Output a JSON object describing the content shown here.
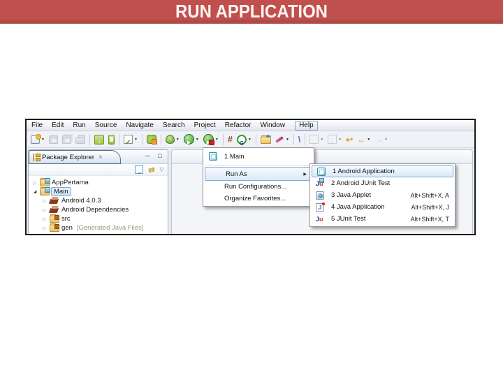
{
  "slide": {
    "title": "RUN APPLICATION",
    "banner_color": "#c0504d",
    "banner_accent_color": "#b14a47"
  },
  "glyphs": {
    "caret": "▼",
    "close": "×",
    "minimize": "─",
    "maximize": "□",
    "view_menu": "▽",
    "collapse_all": "−",
    "link_editor": "⇄",
    "expander_collapsed": "▷",
    "expander_expanded": "◢",
    "submenu_arrow": "▶",
    "run_play": "▶",
    "check": "✓",
    "down": "↓",
    "up": "↑",
    "back": "←",
    "forward": "→",
    "last_edit": "↩",
    "backslash": "\\",
    "hash": "#",
    "coverage_letter": "G",
    "j_letter": "J",
    "u_letter": "u"
  },
  "ide": {
    "menu_bar": {
      "items": [
        "File",
        "Edit",
        "Run",
        "Source",
        "Navigate",
        "Search",
        "Project",
        "Refactor",
        "Window",
        "Help"
      ]
    },
    "toolbar": {
      "icons": [
        "new-wizard",
        "save",
        "save-all",
        "print",
        "android-sdk-manager",
        "avd-manager",
        "new-test-dropdown",
        "android-lint",
        "debug",
        "run",
        "run-external",
        "java-grid",
        "coverage",
        "import-folder",
        "highlighter",
        "mark-occurrences",
        "next-annotation",
        "previous-annotation",
        "last-edit-location",
        "back",
        "forward"
      ]
    },
    "package_explorer": {
      "title": "Package Explorer",
      "tree": [
        {
          "label": "AppPertama"
        },
        {
          "label": "Main"
        },
        {
          "label": "Android 4.0.3"
        },
        {
          "label": "Android Dependencies"
        },
        {
          "label": "src"
        },
        {
          "label": "gen",
          "decoration": "[Generated Java Files]"
        }
      ]
    },
    "run_menu": {
      "items": [
        {
          "label": "1 Main"
        },
        {
          "label": "Run As"
        },
        {
          "label": "Run Configurations..."
        },
        {
          "label": "Organize Favorites..."
        }
      ]
    },
    "run_as_submenu": {
      "items": [
        {
          "label": "1 Android Application"
        },
        {
          "label": "2 Android JUnit Test"
        },
        {
          "label": "3 Java Applet",
          "shortcut": "Alt+Shift+X, A"
        },
        {
          "label": "4 Java Application",
          "shortcut": "Alt+Shift+X, J"
        },
        {
          "label": "5 JUnit Test",
          "shortcut": "Alt+Shift+X, T"
        }
      ]
    },
    "colors": {
      "selection": "#cfe3f7",
      "menu_highlight_border": "#84a8d8"
    }
  }
}
